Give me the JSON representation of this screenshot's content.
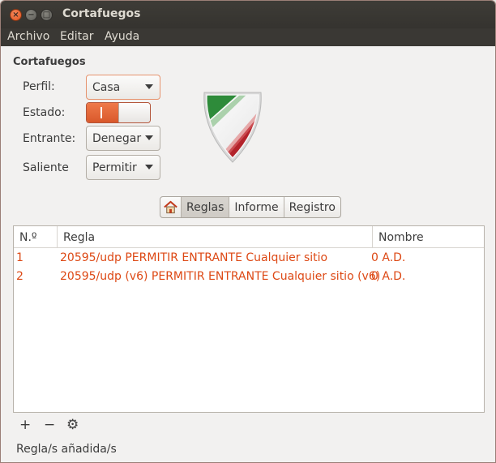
{
  "window": {
    "title": "Cortafuegos",
    "close_glyph": "×",
    "min_glyph": "−",
    "max_glyph": "□"
  },
  "menu": [
    "Archivo",
    "Editar",
    "Ayuda"
  ],
  "section_title": "Cortafuegos",
  "form": {
    "profile_label": "Perfil:",
    "profile_value": "Casa",
    "status_label": "Estado:",
    "status_on": true,
    "incoming_label": "Entrante:",
    "incoming_value": "Denegar",
    "outgoing_label": "Saliente",
    "outgoing_value": "Permitir"
  },
  "tabs": {
    "home_icon": "home-icon",
    "items": [
      "Reglas",
      "Informe",
      "Registro"
    ],
    "active": "Reglas"
  },
  "table": {
    "columns": [
      "N.º",
      "Regla",
      "Nombre"
    ],
    "rows": [
      {
        "num": "1",
        "rule": "20595/udp PERMITIR ENTRANTE Cualquier sitio",
        "name": "0 A.D."
      },
      {
        "num": "2",
        "rule": "20595/udp (v6) PERMITIR ENTRANTE Cualquier sitio (v6)",
        "name": "0 A.D."
      }
    ]
  },
  "toolbar": {
    "add_glyph": "+",
    "remove_glyph": "−",
    "settings_glyph": "⚙"
  },
  "status_text": "Regla/s añadida/s",
  "colors": {
    "accent": "#dd4814",
    "switch_on": "#e8693a"
  }
}
